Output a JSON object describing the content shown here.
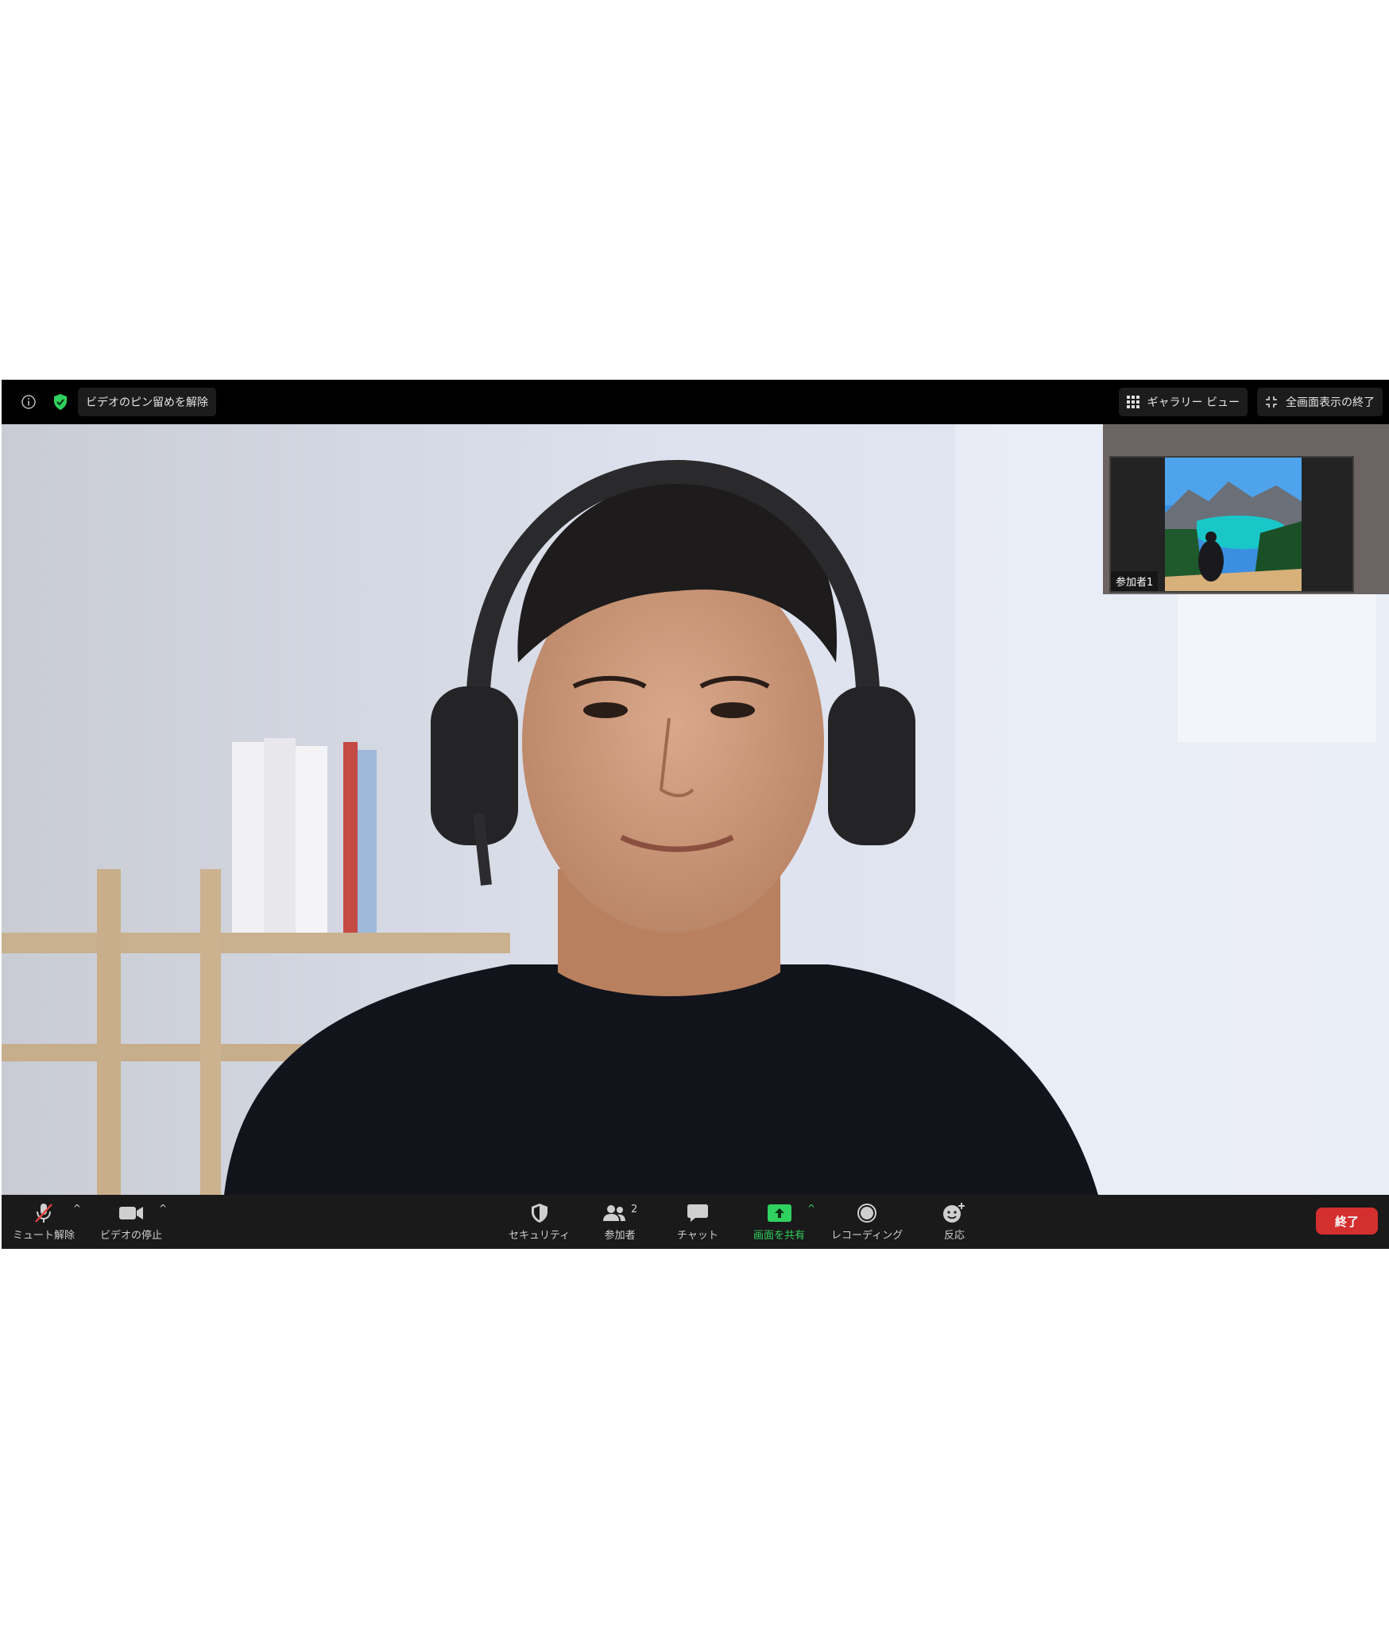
{
  "top_bar": {
    "unpin_label": "ビデオのピン留めを解除",
    "gallery_view_label": "ギャラリー ビュー",
    "exit_fullscreen_label": "全画面表示の終了"
  },
  "thumbnail": {
    "participant_name": "参加者1"
  },
  "toolbar": {
    "unmute_label": "ミュート解除",
    "stop_video_label": "ビデオの停止",
    "security_label": "セキュリティ",
    "participants_label": "参加者",
    "participants_count": "2",
    "chat_label": "チャット",
    "share_screen_label": "画面を共有",
    "recording_label": "レコーディング",
    "reactions_label": "反応",
    "end_label": "終了"
  },
  "colors": {
    "accent_green": "#2fd15f",
    "end_red": "#d32f2f",
    "toolbar_bg": "#1a1a1a",
    "mic_muted_red": "#e0403a"
  },
  "icons": [
    "info-icon",
    "shield-verified-icon",
    "gallery-grid-icon",
    "exit-fullscreen-icon",
    "microphone-muted-icon",
    "video-camera-icon",
    "security-shield-icon",
    "participants-icon",
    "chat-bubble-icon",
    "share-screen-arrow-icon",
    "record-icon",
    "reaction-smiley-icon"
  ]
}
